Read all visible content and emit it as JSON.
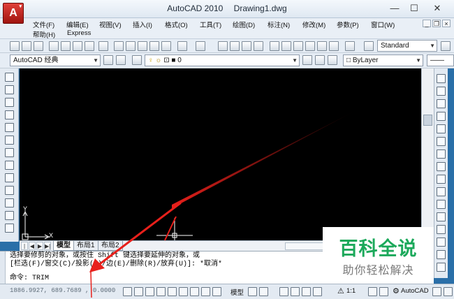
{
  "window": {
    "app_name": "AutoCAD 2010",
    "document": "Drawing1.dwg",
    "app_button_label": "A",
    "minimize": "—",
    "maximize": "☐",
    "close": "✕",
    "doc_minimize": "_",
    "doc_restore": "❐",
    "doc_close": "×"
  },
  "menu": {
    "row1": [
      "文件(F)",
      "编辑(E)",
      "视图(V)",
      "插入(I)",
      "格式(O)",
      "工具(T)",
      "绘图(D)",
      "标注(N)",
      "修改(M)",
      "参数(P)",
      "窗口(W)"
    ],
    "row2": [
      "帮助(H)",
      "Express"
    ]
  },
  "toolbar": {
    "text_style": "Standard",
    "workspace": "AutoCAD 经典",
    "layer": "0",
    "linetype": "ByLayer"
  },
  "canvas": {
    "ucs_x": "X",
    "ucs_y": "Y"
  },
  "tabs": {
    "items": [
      "模型",
      "布局1",
      "布局2"
    ],
    "active_index": 0
  },
  "command": {
    "line1": "选择要修剪的对象，或按住 Shift 键选择要延伸的对象，或",
    "line2": "[栏选(F)/窗交(C)/投影(P)/边(E)/删除(R)/放弃(U)]:  *取消*",
    "prompt": "命令: TRIM"
  },
  "status": {
    "coordinates": "1886.9927, 689.7689 , 0.0000",
    "model_label": "模型",
    "scale": "1:1",
    "workspace_label": "AutoCAD"
  },
  "watermark": {
    "title": "百科全说",
    "subtitle": "助你轻松解决"
  },
  "colors": {
    "canvas": "#000000",
    "arrow": "#e8201b",
    "watermark_green": "#1ca95b",
    "app_red": "#c0281f"
  }
}
